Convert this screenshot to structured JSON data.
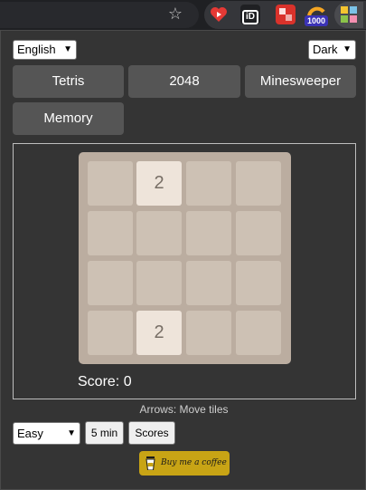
{
  "toolbar": {
    "star_icon": "bookmark-star-icon",
    "extensions": [
      {
        "name": "video-heart-extension-icon",
        "color": "#e53935"
      },
      {
        "name": "id-extension-icon",
        "label": "iD"
      },
      {
        "name": "red-translate-extension-icon",
        "color": "#d9322b"
      },
      {
        "name": "counter-extension-icon",
        "badge": "1000"
      },
      {
        "name": "puzzle-grid-extension-icon"
      }
    ]
  },
  "popup": {
    "language": "English",
    "theme": "Dark",
    "games": [
      "Tetris",
      "2048",
      "Minesweeper",
      "Memory"
    ],
    "board": [
      [
        "",
        "2",
        "",
        ""
      ],
      [
        "",
        "",
        "",
        ""
      ],
      [
        "",
        "",
        "",
        ""
      ],
      [
        "",
        "2",
        "",
        ""
      ]
    ],
    "score_label": "Score: 0",
    "hint": "Arrows: Move tiles",
    "difficulty": "Easy",
    "time_label": "5 min",
    "scores_label": "Scores",
    "coffee_label": "Buy me a coffee"
  },
  "colors": {
    "board_bg": "#bbada0",
    "cell_empty": "#cdc1b4",
    "tile_2": "#eee4da",
    "coffee_bg": "#c8a415"
  }
}
